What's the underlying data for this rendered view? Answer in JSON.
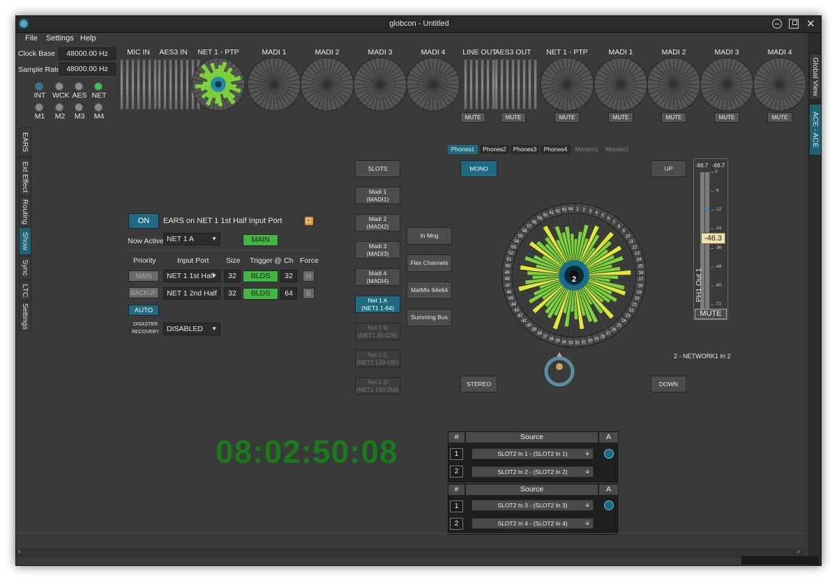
{
  "window": {
    "title": "globcon - Untitled"
  },
  "menu": [
    "File",
    "Settings",
    "Help"
  ],
  "clock": {
    "clock_base_label": "Clock Base",
    "clock_base_value": "48000.00 Hz",
    "sample_rate_label": "Sample Rate",
    "sample_rate_value": "48000.00 Hz"
  },
  "sync_sources": [
    {
      "label": "INT",
      "state": "on"
    },
    {
      "label": "WCK",
      "state": "off"
    },
    {
      "label": "AES",
      "state": "off"
    },
    {
      "label": "NET",
      "state": "net"
    },
    {
      "label": "M1",
      "state": "off"
    },
    {
      "label": "M2",
      "state": "off"
    },
    {
      "label": "M3",
      "state": "off"
    },
    {
      "label": "M4",
      "state": "off"
    }
  ],
  "inputs": [
    "MIC IN",
    "AES3 IN",
    "NET 1 - PTP",
    "MADI 1",
    "MADI 2",
    "MADI 3",
    "MADI 4"
  ],
  "outputs": [
    "LINE OUT",
    "AES3 OUT",
    "NET 1 - PTP",
    "MADI 1",
    "MADI 2",
    "MADI 3",
    "MADI 4"
  ],
  "mute_label": "MUTE",
  "left_tabs": [
    "EARS",
    "Ext Effect",
    "Routing",
    "Show",
    "Sync",
    "LTC",
    "Settings"
  ],
  "left_active": "Show",
  "right_tabs": [
    "Global View",
    "ACE - ACE"
  ],
  "ears": {
    "on_label": "ON",
    "title": "EARS on NET 1 1st Half Input Port",
    "now_active_label": "Now Active",
    "now_active_value": "NET 1 A",
    "main_label": "MAIN",
    "headers": {
      "priority": "Priority",
      "input_port": "Input Port",
      "size": "Size",
      "trigger": "Trigger",
      "at": "@",
      "ch": "Ch",
      "force": "Force"
    },
    "rows": [
      {
        "priority": "MAIN",
        "port": "NET 1 1st Half",
        "size": "32",
        "trigger": "BLDS",
        "ch": "32",
        "force": "M"
      },
      {
        "priority": "BACKUP",
        "port": "NET 1 2nd Half",
        "size": "32",
        "trigger": "BLDS",
        "ch": "64",
        "force": "B"
      }
    ],
    "auto_label": "AUTO",
    "disaster_label_1": "DISASTER",
    "disaster_label_2": "RECOVERY",
    "disaster_value": "DISABLED"
  },
  "timecode": "08:02:50:08",
  "slots": {
    "header": "SLOTS",
    "items": [
      {
        "line1": "Madi 1",
        "line2": "(MADI1)",
        "state": "normal"
      },
      {
        "line1": "Madi 2",
        "line2": "(MADI2)",
        "state": "normal"
      },
      {
        "line1": "Madi 3",
        "line2": "(MADI3)",
        "state": "normal"
      },
      {
        "line1": "Madi 4",
        "line2": "(MADI4)",
        "state": "normal"
      },
      {
        "line1": "Net 1 A",
        "line2": "(NET1 1-64)",
        "state": "active"
      },
      {
        "line1": "Net 1 B",
        "line2": "(NET1 65-128)",
        "state": "disabled"
      },
      {
        "line1": "Net 1 C",
        "line2": "(NET1 129-192)",
        "state": "disabled"
      },
      {
        "line1": "Net 1 D",
        "line2": "(NET1 193-256)",
        "state": "disabled"
      }
    ],
    "side": [
      "In Mng",
      "Flex Channels",
      "MatMix 64x64",
      "Summing Bus"
    ]
  },
  "monitor": {
    "tabs": [
      {
        "label": "Phones1",
        "state": "active"
      },
      {
        "label": "Phones2",
        "state": "normal"
      },
      {
        "label": "Phones3",
        "state": "normal"
      },
      {
        "label": "Phones4",
        "state": "normal"
      },
      {
        "label": "Monitor1",
        "state": "disabled"
      },
      {
        "label": "Monitor2",
        "state": "disabled"
      }
    ],
    "mono": "MONO",
    "stereo": "STEREO",
    "up": "UP",
    "down": "DOWN",
    "selected_channel": "2",
    "channel_name": "2 - NETWORK1 In 2",
    "fader": {
      "peak_left": "-66.7",
      "peak_right": "-66.7",
      "value": "-46.3",
      "level": 0.5,
      "label": "PH1 Out 1",
      "mute": "MUTE",
      "scale": [
        "0",
        "-6",
        "-12",
        "-24",
        "-36",
        "-48",
        "-60",
        "-72"
      ]
    },
    "dial_numbers": [
      "1",
      "2",
      "3",
      "4",
      "5",
      "6",
      "7",
      "8",
      "9",
      "10",
      "11",
      "12",
      "13",
      "14",
      "15",
      "16",
      "17",
      "18",
      "19",
      "20",
      "21",
      "22",
      "23",
      "24",
      "25",
      "26",
      "27",
      "28",
      "29",
      "30",
      "31",
      "32",
      "33",
      "34",
      "35",
      "36",
      "37",
      "38",
      "39",
      "40",
      "41",
      "42",
      "43",
      "44",
      "45",
      "46",
      "47",
      "48",
      "49",
      "50",
      "51",
      "52",
      "53",
      "54",
      "55",
      "56",
      "57",
      "58",
      "59",
      "60",
      "61",
      "62",
      "63",
      "64"
    ]
  },
  "routing": {
    "headers": {
      "num": "#",
      "source": "Source",
      "a": "A"
    },
    "groups": [
      {
        "rows": [
          {
            "num": "1",
            "source": "SLOT2 In 1 - (SLOT2 In 1)"
          },
          {
            "num": "2",
            "source": "SLOT2 In 2 - (SLOT2 In 2)"
          }
        ]
      },
      {
        "rows": [
          {
            "num": "1",
            "source": "SLOT2 In 3 - (SLOT2 In 3)"
          },
          {
            "num": "2",
            "source": "SLOT2 In 4 - (SLOT2 In 4)"
          }
        ]
      }
    ]
  },
  "colors": {
    "accent": "#1d6a82",
    "green": "#42b642",
    "meter_green": "#7ed33a",
    "meter_yellow": "#e2e83a",
    "timecode": "#1a7a1a"
  }
}
